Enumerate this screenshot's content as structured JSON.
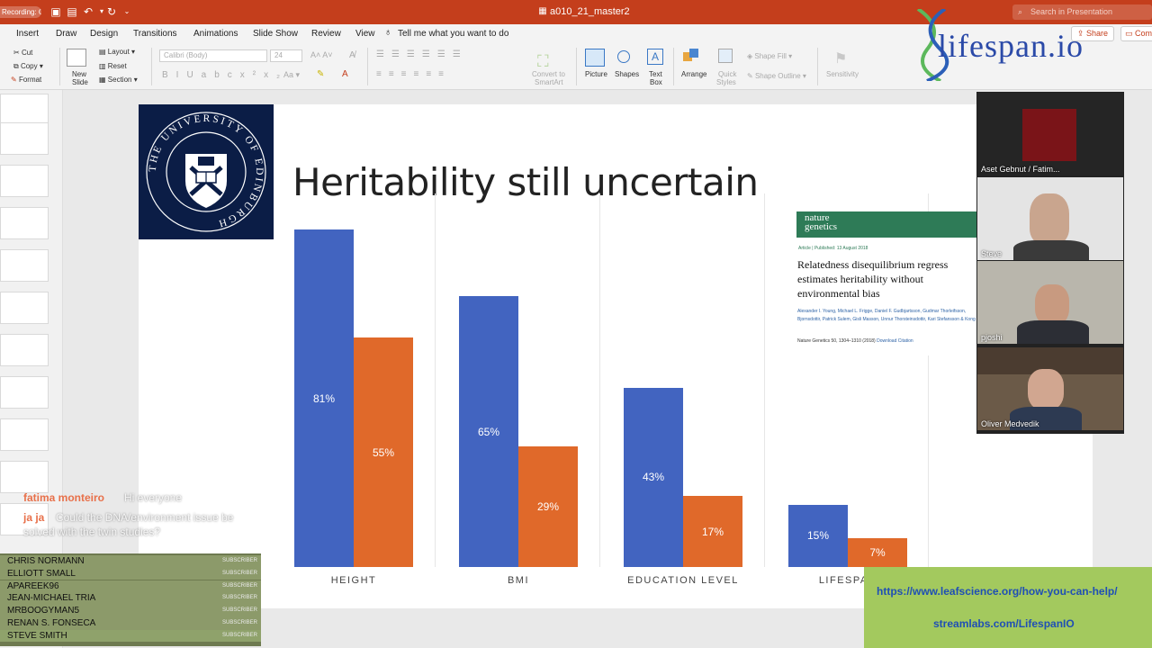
{
  "titlebar": {
    "recording": "Recording: OFF",
    "doc_title": "a010_21_master2",
    "search_placeholder": "Search in Presentation"
  },
  "tabs": [
    "Insert",
    "Draw",
    "Design",
    "Transitions",
    "Animations",
    "Slide Show",
    "Review",
    "View"
  ],
  "tell_me": "Tell me what you want to do",
  "share": "Share",
  "comments": "Comm",
  "ribbon": {
    "cut": "Cut",
    "copy": "Copy",
    "format": "Format",
    "new_slide_1": "New",
    "new_slide_2": "Slide",
    "layout": "Layout",
    "reset": "Reset",
    "section": "Section",
    "font_name": "Calibri (Body)",
    "font_size": "24",
    "convert_1": "Convert to",
    "convert_2": "SmartArt",
    "picture": "Picture",
    "shapes": "Shapes",
    "text_box_1": "Text",
    "text_box_2": "Box",
    "arrange": "Arrange",
    "quick_styles_1": "Quick",
    "quick_styles_2": "Styles",
    "shape_fill": "Shape Fill",
    "shape_outline": "Shape Outline",
    "sensitivity": "Sensitivity"
  },
  "slide": {
    "title": "Heritability still uncertain",
    "logo_text": "THE UNIVERSITY OF EDINBURGH"
  },
  "chart_data": {
    "type": "bar",
    "categories": [
      "HEIGHT",
      "BMI",
      "EDUCATION LEVEL",
      "LIFESPAN"
    ],
    "series": [
      {
        "values": [
          81,
          65,
          43,
          15
        ],
        "labels": [
          "81%",
          "65%",
          "43%",
          "15%"
        ],
        "color": "#4264c0"
      },
      {
        "values": [
          55,
          29,
          17,
          7
        ],
        "labels": [
          "55%",
          "29%",
          "17%",
          "7%"
        ],
        "color": "#e0692a"
      }
    ],
    "ylim": [
      0,
      81
    ],
    "legend": "none",
    "grid": false
  },
  "article": {
    "journal": "nature genetics",
    "meta": "Article  |  Published: 13 August 2018",
    "title": "Relatedness disequilibrium regress estimates heritability without environmental bias",
    "authors": "Alexander I. Young, Michael L. Frigge, Daniel F. Gudbjartsson, Gudmar Thorleifsson, Bjornsdottir, Patrick Sulem, Gisli Masson, Unnur Thorsteinsdottir, Kari Stefansson & Kong",
    "citation": "Nature Genetics 50, 1304–1310 (2018)",
    "download": "Download Citation"
  },
  "brand": {
    "logo_text": "lifespan.io"
  },
  "cams": [
    {
      "name": "Aset Gebnut / Fatim..."
    },
    {
      "name": "Steve"
    },
    {
      "name": "pjoshi"
    },
    {
      "name": "Oliver Medvedik"
    }
  ],
  "chat": [
    {
      "name": "fatima monteiro",
      "msg": "Hi everyone"
    },
    {
      "name": "ja ja",
      "msg": "Could the DNA/environment issue be",
      "msg2": "solved with the twin studies?"
    }
  ],
  "subscribers": [
    "CHRIS NORMANN",
    "ELLIOTT SMALL",
    "APAREEK96",
    "JEAN-MICHAEL TRIA",
    "MRBOOGYMAN5",
    "RENAN S. FONSECA",
    "STEVE SMITH"
  ],
  "subscriber_tag": "SUBSCRIBER",
  "banner": {
    "link1": "https://www.leafscience.org/how-you-can-help/",
    "link2": "streamlabs.com/LifespanIO"
  },
  "colors": {
    "accent": "#c43e1c",
    "bar_blue": "#4264c0",
    "bar_orange": "#e0692a",
    "banner": "#a3c95e"
  }
}
